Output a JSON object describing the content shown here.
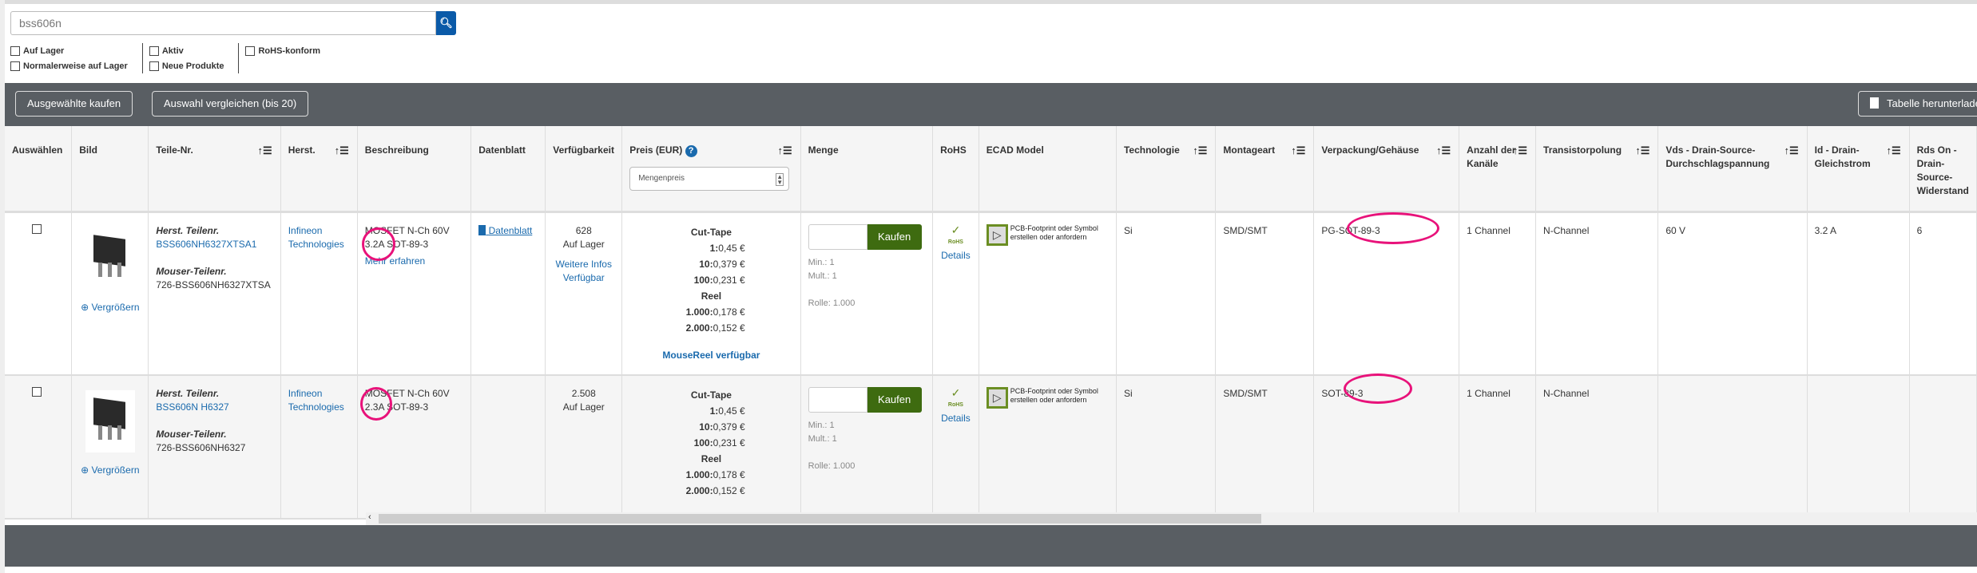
{
  "search": {
    "value": "bss606n"
  },
  "filters": [
    [
      "Auf Lager",
      "Normalerweise auf Lager"
    ],
    [
      "Aktiv",
      "Neue Produkte"
    ],
    [
      "RoHS-konform"
    ]
  ],
  "toolbar": {
    "buy_selected": "Ausgewählte kaufen",
    "compare": "Auswahl vergleichen (bis 20)",
    "download": "Tabelle herunterladen"
  },
  "columns": [
    "Auswählen",
    "Bild",
    "Teile-Nr.",
    "Herst.",
    "Beschreibung",
    "Datenblatt",
    "Verfügbarkeit",
    "Preis (EUR)",
    "Menge",
    "RoHS",
    "ECAD Model",
    "Technologie",
    "Montageart",
    "Verpackung/Gehäuse",
    "Anzahl der Kanäle",
    "Transistorpolung",
    "Vds - Drain-Source-Durchschlagspannung",
    "Id - Drain-Gleichstrom",
    "Rds On - Drain-Source-Widerstand"
  ],
  "price_select": "Mengenpreis",
  "labels": {
    "enlarge": "Vergrößern",
    "mfr_pn": "Herst. Teilenr.",
    "mouser_pn": "Mouser-Teilenr.",
    "learn_more": "Mehr erfahren",
    "datasheet": "Datenblatt",
    "buy": "Kaufen",
    "details": "Details",
    "ecad": "PCB-Footprint oder Symbol erstellen oder anfordern",
    "cut_tape": "Cut-Tape",
    "reel": "Reel",
    "more_info": "Weitere Infos Verfügbar",
    "mousereel": "MouseReel verfügbar"
  },
  "rows": [
    {
      "mfr_pn": "BSS606NH6327XTSA1",
      "mouser_pn": "726-BSS606NH6327XTSA",
      "mfr": "Infineon Technologies",
      "desc1": "MOSFET N-Ch 60V",
      "desc2": "3.2A SOT-89-3",
      "stock": "628",
      "stock_label": "Auf Lager",
      "cut": [
        [
          "1:",
          "0,45 €"
        ],
        [
          "10:",
          "0,379 €"
        ],
        [
          "100:",
          "0,231 €"
        ]
      ],
      "reel": [
        [
          "1.000:",
          "0,178 €"
        ],
        [
          "2.000:",
          "0,152 €"
        ]
      ],
      "min": "Min.: 1",
      "mult": "Mult.: 1",
      "rolle": "Rolle: 1.000",
      "tech": "Si",
      "mount": "SMD/SMT",
      "pkg": "PG-SOT-89-3",
      "channels": "1 Channel",
      "polarity": "N-Channel",
      "vds": "60 V",
      "id": "3.2 A",
      "rds": "6"
    },
    {
      "mfr_pn": "BSS606N H6327",
      "mouser_pn": "726-BSS606NH6327",
      "mfr": "Infineon Technologies",
      "desc1": "MOSFET N-Ch 60V",
      "desc2": "2.3A SOT-89-3",
      "stock": "2.508",
      "stock_label": "Auf Lager",
      "cut": [
        [
          "1:",
          "0,45 €"
        ],
        [
          "10:",
          "0,379 €"
        ],
        [
          "100:",
          "0,231 €"
        ]
      ],
      "reel": [
        [
          "1.000:",
          "0,178 €"
        ],
        [
          "2.000:",
          "0,152 €"
        ]
      ],
      "min": "Min.: 1",
      "mult": "Mult.: 1",
      "rolle": "Rolle: 1.000",
      "tech": "Si",
      "mount": "SMD/SMT",
      "pkg": "SOT-89-3",
      "channels": "1 Channel",
      "polarity": "N-Channel",
      "vds": "",
      "id": "",
      "rds": ""
    }
  ]
}
